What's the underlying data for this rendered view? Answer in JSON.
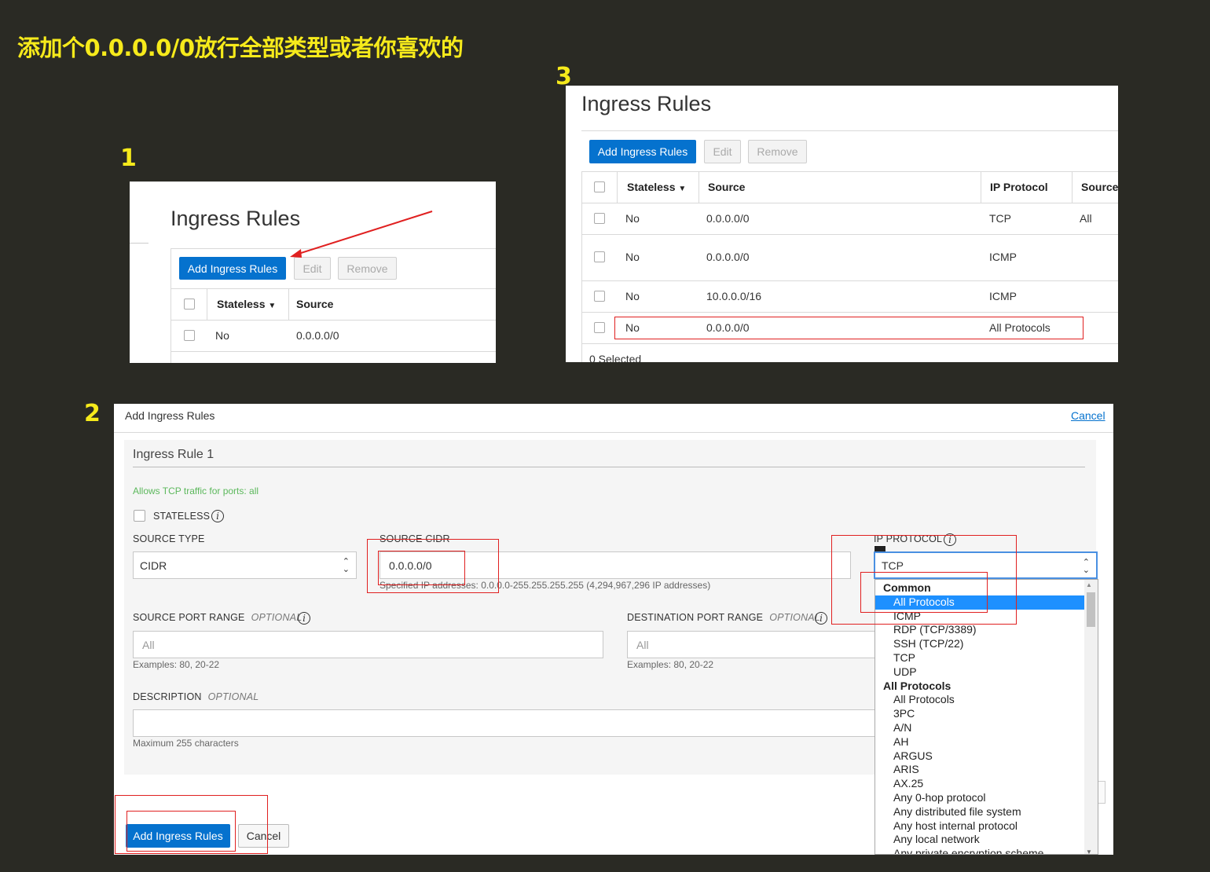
{
  "heading": "添加个0.0.0.0/0放行全部类型或者你喜欢的",
  "steps": {
    "s1": "1",
    "s2": "2",
    "s3": "3"
  },
  "panel1": {
    "title": "Ingress Rules",
    "add_button": "Add Ingress Rules",
    "edit_button": "Edit",
    "remove_button": "Remove",
    "columns": [
      "Stateless",
      "Source"
    ],
    "rows": [
      {
        "stateless": "No",
        "source": "0.0.0.0/0"
      }
    ]
  },
  "panel3": {
    "title": "Ingress Rules",
    "add_button": "Add Ingress Rules",
    "edit_button": "Edit",
    "remove_button": "Remove",
    "columns": [
      "Stateless",
      "Source",
      "IP Protocol",
      "Source"
    ],
    "rows": [
      {
        "stateless": "No",
        "source": "0.0.0.0/0",
        "protocol": "TCP",
        "source_port": "All"
      },
      {
        "stateless": "No",
        "source": "0.0.0.0/0",
        "protocol": "ICMP",
        "source_port": ""
      },
      {
        "stateless": "No",
        "source": "10.0.0.0/16",
        "protocol": "ICMP",
        "source_port": ""
      },
      {
        "stateless": "No",
        "source": "0.0.0.0/0",
        "protocol": "All Protocols",
        "source_port": ""
      }
    ],
    "footer": "0 Selected"
  },
  "dialog": {
    "title": "Add Ingress Rules",
    "cancel_link": "Cancel",
    "rule_title": "Ingress Rule 1",
    "allows_text": "Allows TCP traffic for ports: all",
    "stateless_label": "STATELESS",
    "source_type_label": "SOURCE TYPE",
    "source_type_value": "CIDR",
    "source_cidr_label": "SOURCE CIDR",
    "source_cidr_value": "0.0.0.0/0",
    "source_cidr_hint": "Specified IP addresses: 0.0.0.0-255.255.255.255 (4,294,967,296 IP addresses)",
    "ip_protocol_label": "IP PROTOCOL",
    "ip_protocol_value": "TCP",
    "source_port_label": "SOURCE PORT RANGE",
    "dest_port_label": "DESTINATION PORT RANGE",
    "optional": "OPTIONAL",
    "port_placeholder": "All",
    "port_hint": "Examples: 80, 20-22",
    "description_label": "DESCRIPTION",
    "description_hint": "Maximum 255 characters",
    "submit_button": "Add Ingress Rules",
    "cancel_button": "Cancel"
  },
  "dropdown": {
    "groups": [
      {
        "label": "Common",
        "items": [
          "All Protocols",
          "ICMP",
          "RDP (TCP/3389)",
          "SSH (TCP/22)",
          "TCP",
          "UDP"
        ]
      },
      {
        "label": "All Protocols",
        "items": [
          "All Protocols",
          "3PC",
          "A/N",
          "AH",
          "ARGUS",
          "ARIS",
          "AX.25",
          "Any 0-hop protocol",
          "Any distributed file system",
          "Any host internal protocol",
          "Any local network",
          "Any private encryption scheme"
        ]
      }
    ],
    "selected": "All Protocols"
  },
  "colors": {
    "accent": "#0572ce",
    "annotation": "#e02020",
    "heading": "#f6ea1b",
    "success": "#5cb85c",
    "selection": "#1e90ff"
  }
}
